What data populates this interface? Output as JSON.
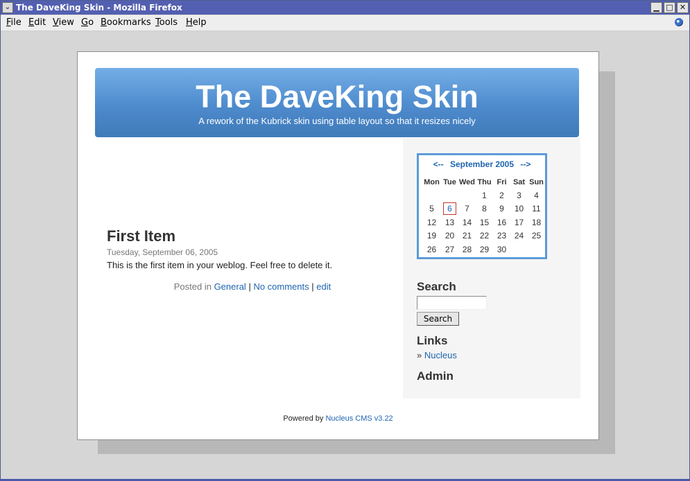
{
  "window": {
    "title": "The DaveKing Skin - Mozilla Firefox",
    "menu": [
      "File",
      "Edit",
      "View",
      "Go",
      "Bookmarks",
      "Tools",
      "Help"
    ],
    "buttons": {
      "minimize": "▁",
      "maximize": "□",
      "close": "✕"
    }
  },
  "blog": {
    "title": "The DaveKing Skin",
    "description": "A rework of the Kubrick skin using table layout so that it resizes nicely"
  },
  "item": {
    "title": "First Item",
    "date": "Tuesday, September 06, 2005",
    "body": "This is the first item in your weblog. Feel free to delete it.",
    "posted_in": "Posted in",
    "category": "General",
    "comments": "No comments",
    "edit": "edit",
    "separator": "|"
  },
  "calendar": {
    "prev": "<--",
    "month": "September 2005",
    "next": "-->",
    "days": [
      "Mon",
      "Tue",
      "Wed",
      "Thu",
      "Fri",
      "Sat",
      "Sun"
    ],
    "weeks": [
      [
        "",
        "",
        "",
        "1",
        "2",
        "3",
        "4"
      ],
      [
        "5",
        "6",
        "7",
        "8",
        "9",
        "10",
        "11"
      ],
      [
        "12",
        "13",
        "14",
        "15",
        "16",
        "17",
        "18"
      ],
      [
        "19",
        "20",
        "21",
        "22",
        "23",
        "24",
        "25"
      ],
      [
        "26",
        "27",
        "28",
        "29",
        "30",
        "",
        ""
      ]
    ],
    "today": "6"
  },
  "sidebar": {
    "search_heading": "Search",
    "search_value": "",
    "search_button": "Search",
    "links_heading": "Links",
    "link_bullet": "»",
    "link_label": "Nucleus",
    "admin_heading": "Admin"
  },
  "footer": {
    "powered_by": "Powered by",
    "cms_link": "Nucleus CMS v3.22"
  },
  "colors": {
    "link": "#1e64b0",
    "header_top": "#74aee7",
    "header_bottom": "#3f7ab8",
    "calendar_border": "#5b9bd8",
    "today_border": "#c0392b"
  }
}
